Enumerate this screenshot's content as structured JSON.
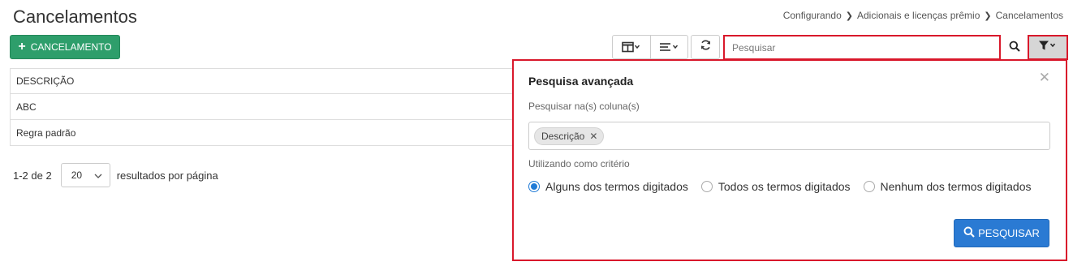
{
  "page": {
    "title": "Cancelamentos",
    "breadcrumb": [
      "Configurando",
      "Adicionais e licenças prêmio",
      "Cancelamentos"
    ]
  },
  "toolbar": {
    "add_label": "CANCELAMENTO",
    "search_placeholder": "Pesquisar",
    "icons": [
      "columns-icon",
      "density-icon",
      "refresh-icon",
      "search-icon",
      "filter-icon"
    ]
  },
  "grid": {
    "header": "DESCRIÇÃO",
    "rows": [
      "ABC",
      "Regra padrão"
    ]
  },
  "pager": {
    "count": "1-2 de 2",
    "page_size": "20",
    "suffix": "resultados por página"
  },
  "advanced_search": {
    "title": "Pesquisa avançada",
    "columns_label": "Pesquisar na(s) coluna(s)",
    "selected_column": "Descrição",
    "criteria_label": "Utilizando como critério",
    "options": [
      "Alguns dos termos digitados",
      "Todos os termos digitados",
      "Nenhum dos termos digitados"
    ],
    "selected_option": "Alguns dos termos digitados",
    "submit_label": "PESQUISAR"
  },
  "colors": {
    "add_button": "#2e9e6b",
    "primary": "#2a7ad3",
    "highlight": "#d9182b"
  }
}
